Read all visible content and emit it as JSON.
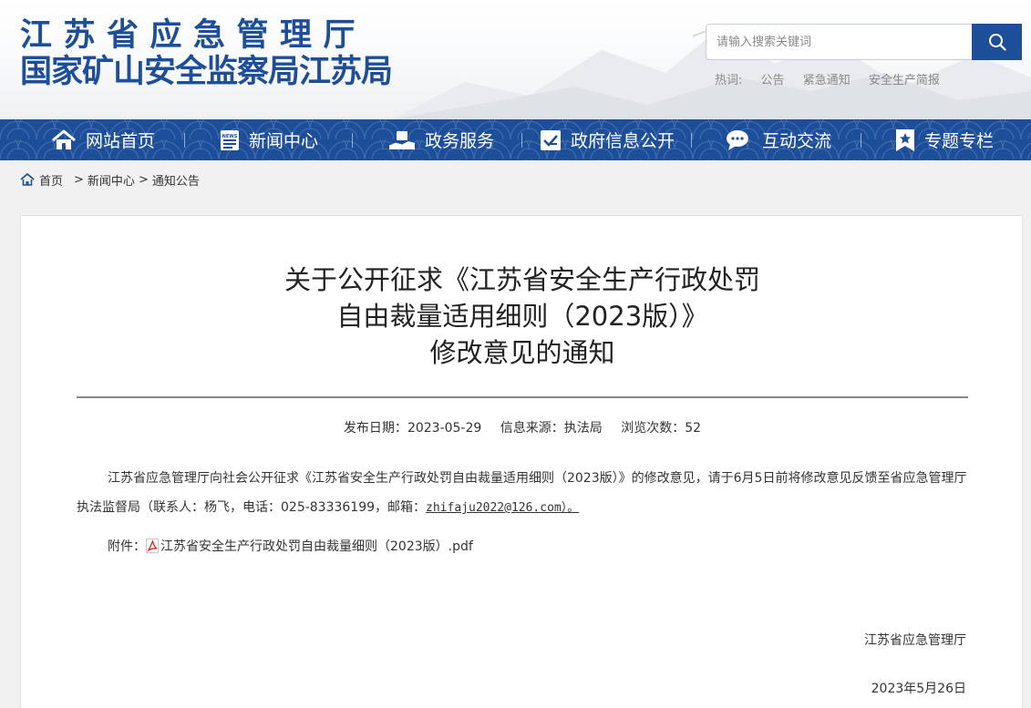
{
  "header": {
    "org_line1": "江苏省应急管理厅",
    "org_line2": "国家矿山安全监察局江苏局",
    "search_placeholder": "请输入搜索关键词",
    "hot_label": "热词:",
    "hot_words": [
      "公告",
      "紧急通知",
      "安全生产简报"
    ]
  },
  "nav": {
    "items": [
      {
        "label": "网站首页",
        "icon": "home-icon"
      },
      {
        "label": "新闻中心",
        "icon": "news-icon"
      },
      {
        "label": "政务服务",
        "icon": "service-icon"
      },
      {
        "label": "政府信息公开",
        "icon": "info-disclosure-icon"
      },
      {
        "label": "互动交流",
        "icon": "chat-icon"
      },
      {
        "label": "专题专栏",
        "icon": "bookmark-star-icon"
      }
    ]
  },
  "breadcrumb": {
    "home": "首页",
    "items": [
      "新闻中心",
      "通知公告"
    ],
    "separator": ">"
  },
  "article": {
    "title_lines": [
      "关于公开征求《江苏省安全生产行政处罚",
      "自由裁量适用细则（2023版）》",
      "修改意见的通知"
    ],
    "meta": {
      "date_label": "发布日期：",
      "date": "2023-05-29",
      "source_label": "信息来源：",
      "source": "执法局",
      "views_label": "浏览次数：",
      "views": "52"
    },
    "body_before_email": "江苏省应急管理厅向社会公开征求《江苏省安全生产行政处罚自由裁量适用细则（2023版）》的修改意见，请于6月5日前将修改意见反馈至省应急管理厅执法监督局（联系人：杨飞，电话：025-83336199，邮箱：",
    "email": "zhifaju2022@126.com）。",
    "attachment_label": "附件：",
    "attachment_name": "江苏省安全生产行政处罚自由裁量细则（2023版）.pdf",
    "signature": "江苏省应急管理厅",
    "sign_date": "2023年5月26日"
  },
  "colors": {
    "brand_blue": "#1c4e9a",
    "pdf_red": "#d9261c"
  }
}
